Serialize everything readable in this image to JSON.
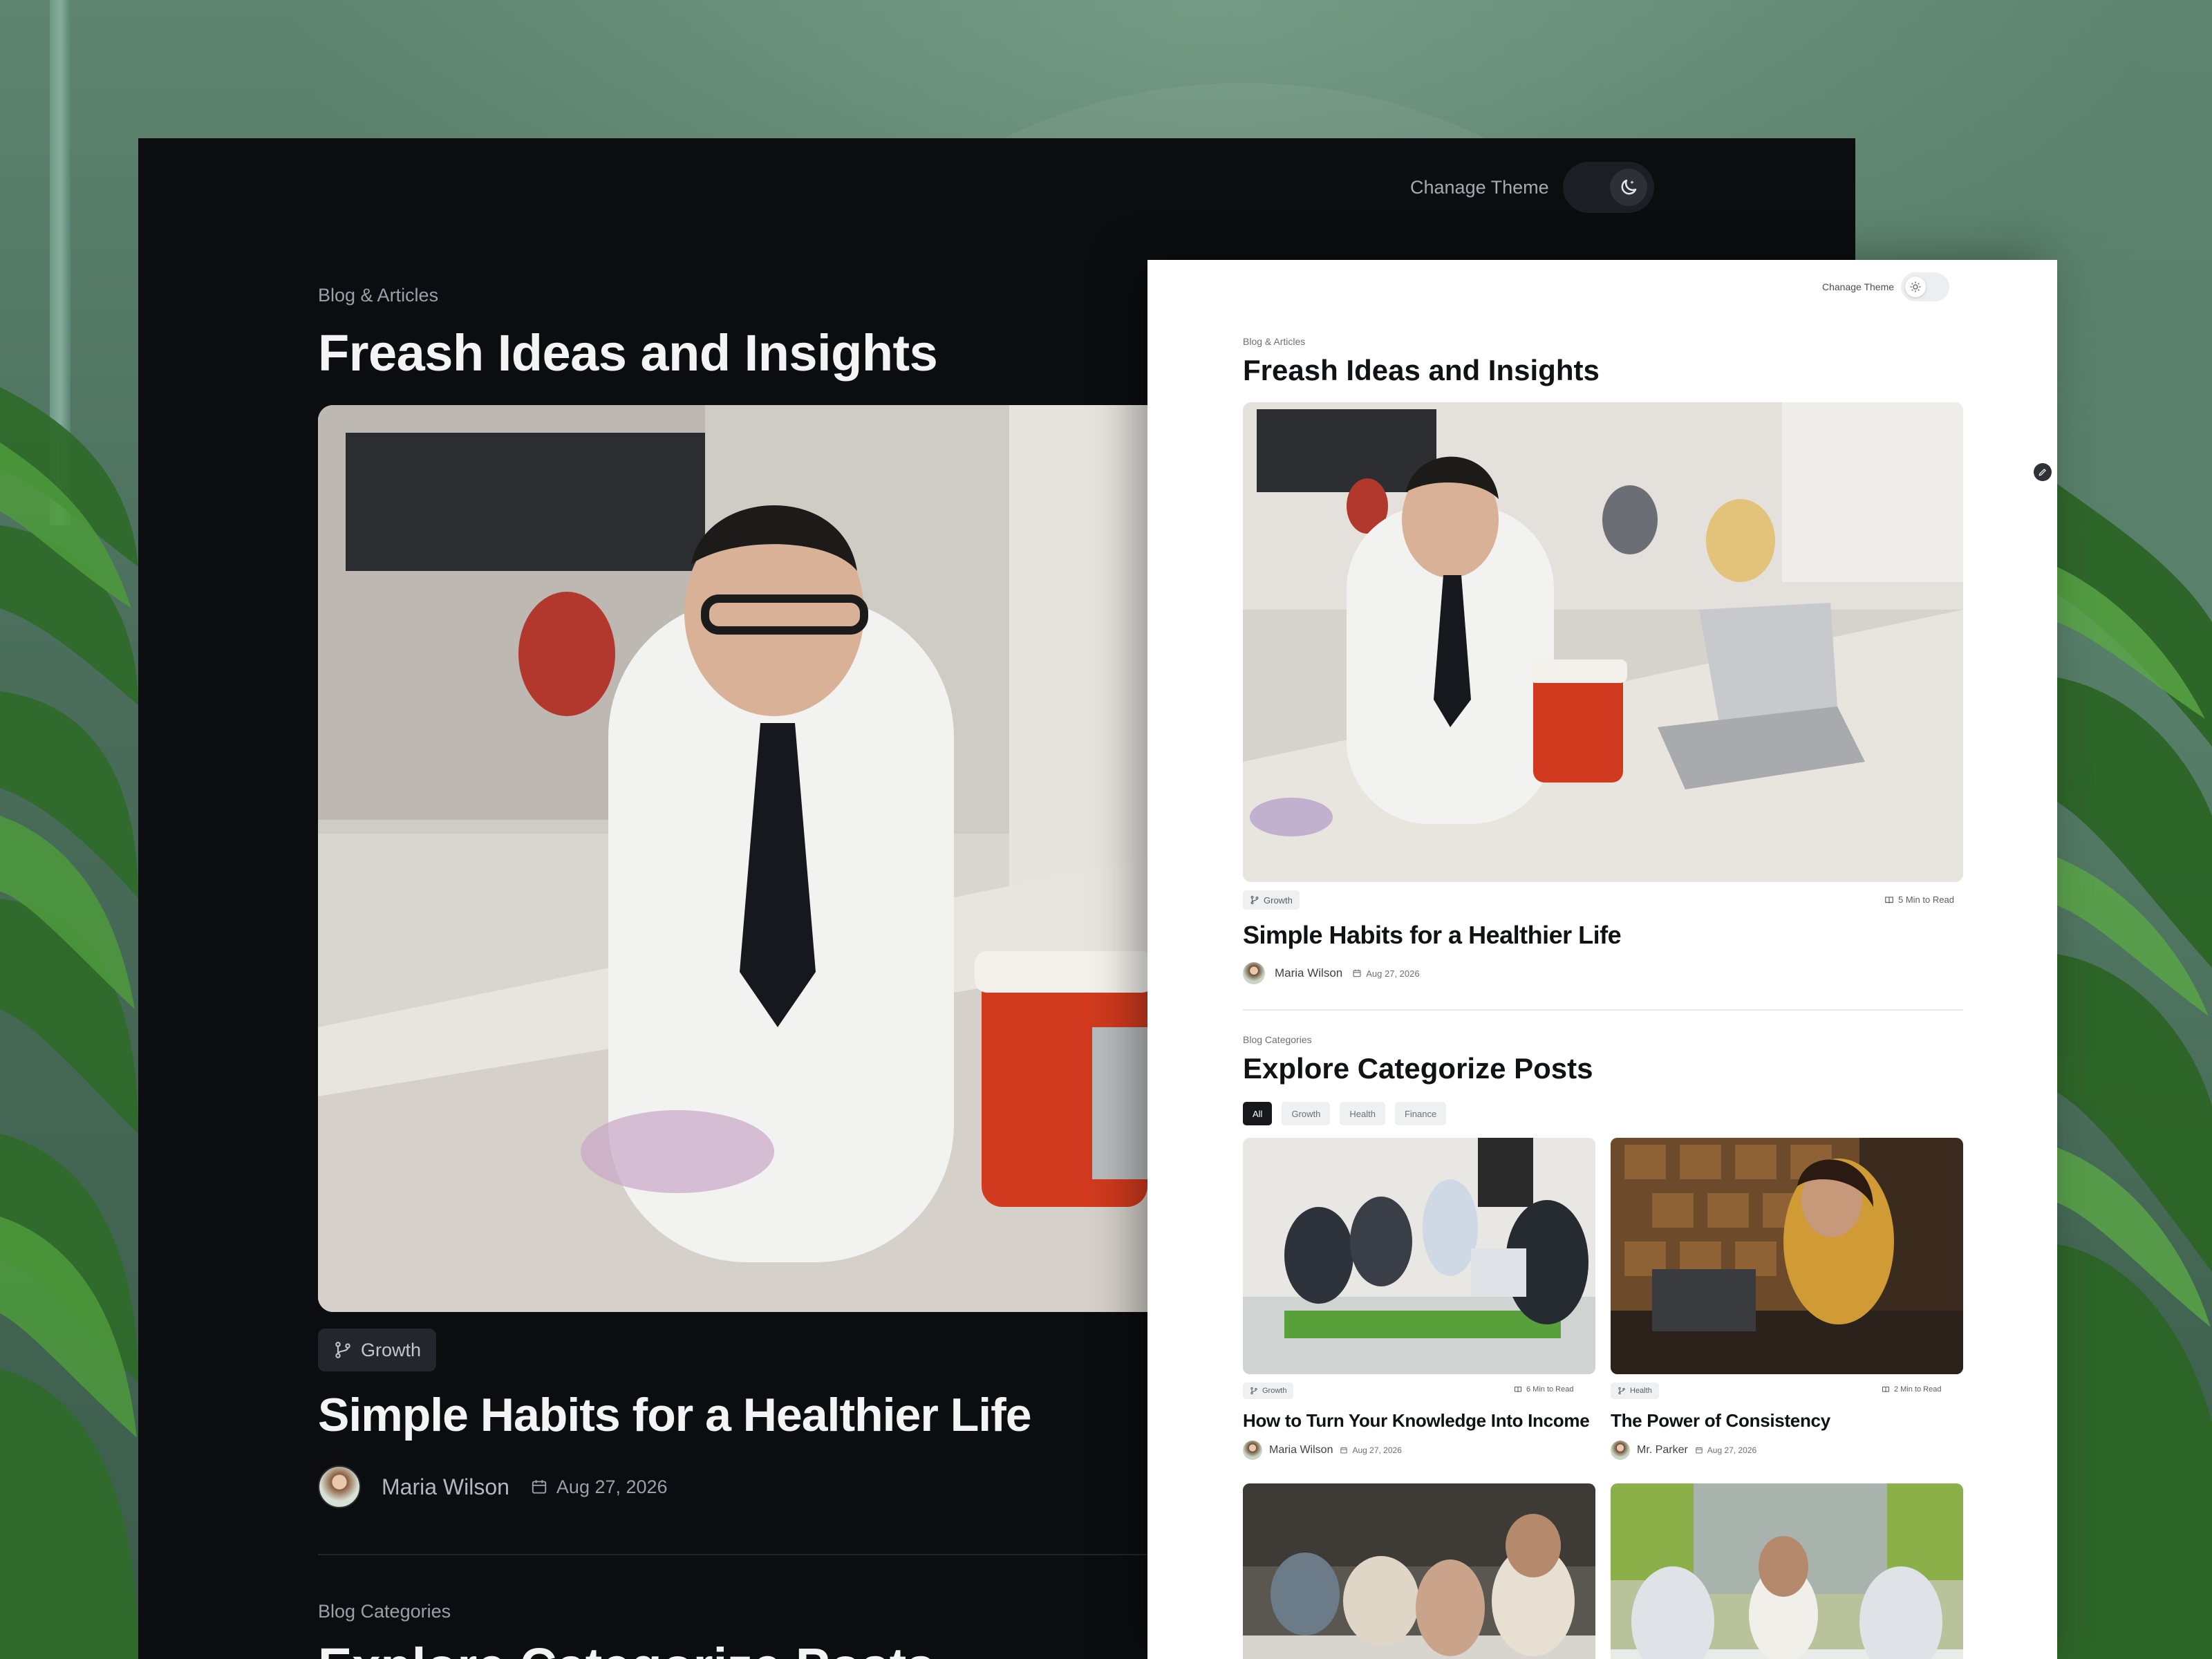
{
  "dark": {
    "theme_label": "Chanage Theme",
    "eyebrow": "Blog & Articles",
    "title": "Freash Ideas and Insights",
    "featured": {
      "tag": "Growth",
      "title": "Simple Habits for a Healthier Life",
      "author": "Maria Wilson",
      "date": "Aug 27, 2026"
    },
    "categories_eyebrow": "Blog Categories",
    "categories_title": "Explore Categorize Posts"
  },
  "light": {
    "theme_label": "Chanage Theme",
    "eyebrow": "Blog & Articles",
    "title": "Freash Ideas and Insights",
    "featured": {
      "tag": "Growth",
      "read_time": "5 Min to Read",
      "title": "Simple Habits for a Healthier Life",
      "author": "Maria Wilson",
      "date": "Aug 27, 2026"
    },
    "categories_eyebrow": "Blog Categories",
    "categories_title": "Explore Categorize Posts",
    "filters": [
      "All",
      "Growth",
      "Health",
      "Finance"
    ],
    "posts": [
      {
        "tag": "Growth",
        "read_time": "6 Min to Read",
        "title": "How to Turn Your Knowledge Into Income",
        "author": "Maria Wilson",
        "date": "Aug 27, 2026"
      },
      {
        "tag": "Health",
        "read_time": "2 Min to Read",
        "title": "The Power of Consistency",
        "author": "Mr. Parker",
        "date": "Aug 27, 2026"
      }
    ]
  },
  "icons": {
    "theme_dark": "moon-icon",
    "theme_light": "sun-icon",
    "tag": "branch-icon",
    "date": "calendar-icon",
    "read": "book-icon"
  },
  "colors": {
    "dark_bg": "#0c0d10",
    "light_bg": "#ffffff",
    "text_dark": "#111216",
    "filter_active": "#17181c"
  }
}
